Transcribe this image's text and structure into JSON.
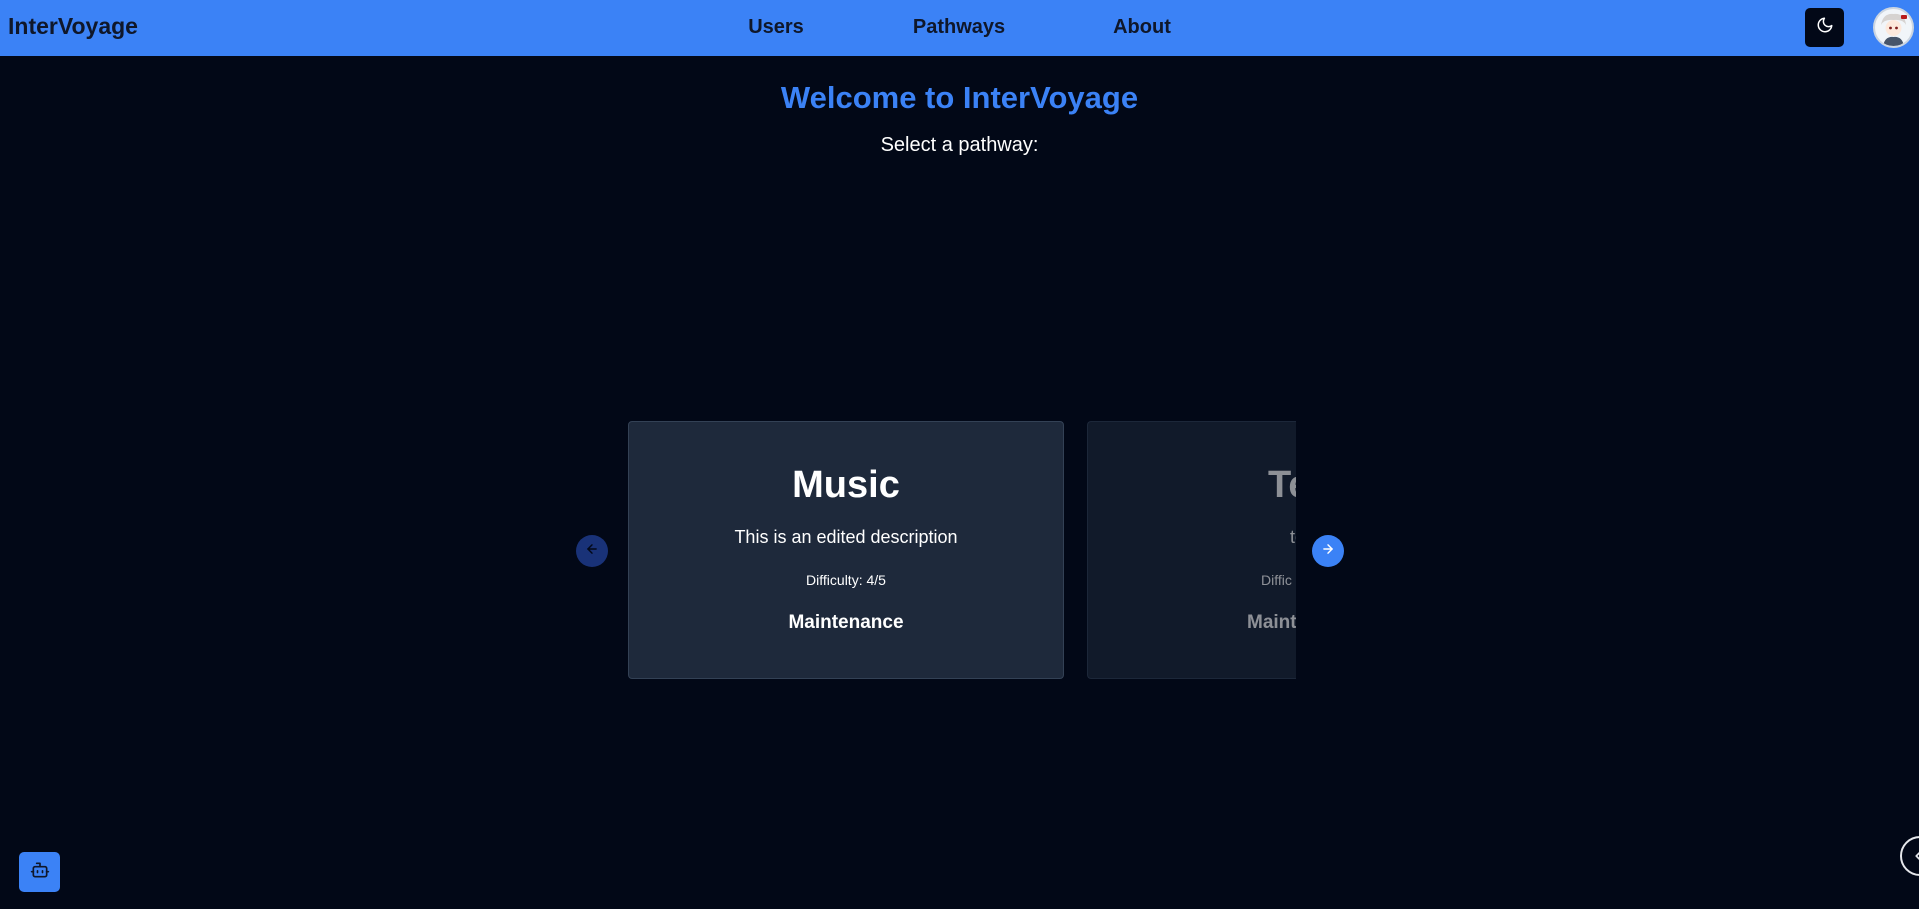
{
  "navbar": {
    "brand": "InterVoyage",
    "links": [
      {
        "label": "Users"
      },
      {
        "label": "Pathways"
      },
      {
        "label": "About"
      }
    ],
    "theme_icon": "moon-icon",
    "avatar_icon": "avatar"
  },
  "main": {
    "title": "Welcome to InterVoyage",
    "subtitle": "Select a pathway:"
  },
  "carousel": {
    "prev_icon": "arrow-left-icon",
    "next_icon": "arrow-right-icon",
    "cards": [
      {
        "title": "Music",
        "description": "This is an edited description",
        "difficulty": "Difficulty: 4/5",
        "category": "Maintenance"
      },
      {
        "title": "Te",
        "description": "te",
        "difficulty": "Diffic",
        "category": "Maint"
      }
    ]
  },
  "floating": {
    "bot_icon": "bot-icon"
  },
  "colors": {
    "navbar": "#3b82f6",
    "background": "#020817",
    "card": "#1e293b",
    "accent": "#3b82f6"
  }
}
